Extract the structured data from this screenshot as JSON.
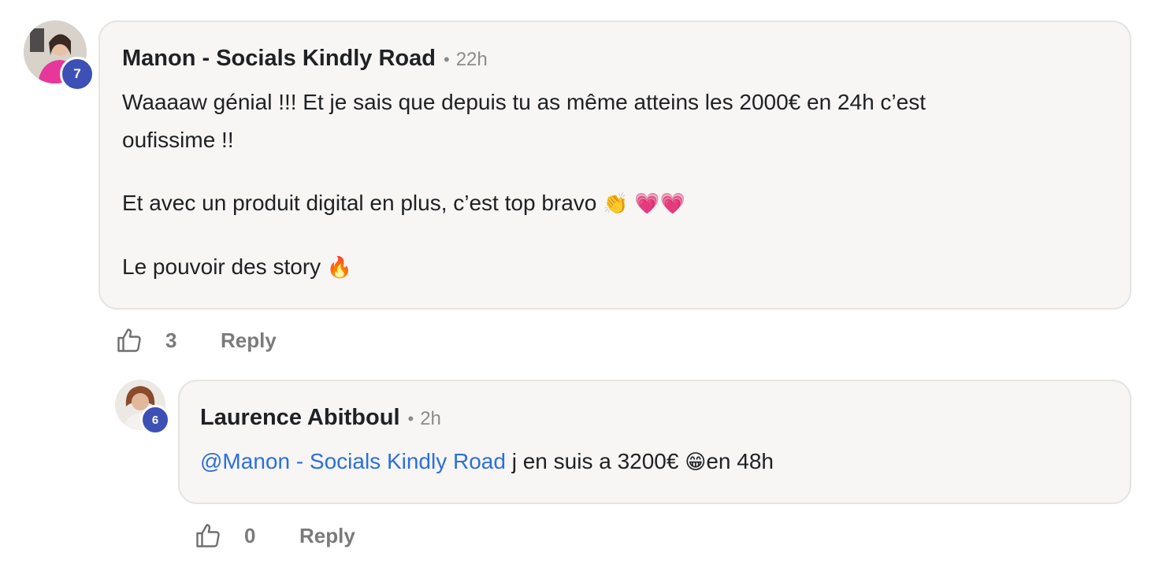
{
  "comments": [
    {
      "author": "Manon - Socials Kindly Road",
      "separator": "•",
      "time": "22h",
      "level": "7",
      "paragraphs": [
        "Waaaaw génial !!! Et je sais que depuis tu as même atteins les 2000€ en 24h c’est",
        "oufissime !!",
        "Et avec un produit digital en plus, c’est top bravo",
        "Le pouvoir des story"
      ],
      "emojis": {
        "clap": "👏",
        "hearts": "💗💗",
        "fire": "🔥"
      },
      "likes": "3",
      "reply_label": "Reply",
      "icons": {
        "like": "thumbs-up-icon"
      }
    },
    {
      "author": "Laurence Abitboul",
      "separator": "•",
      "time": "2h",
      "level": "6",
      "mention": "@Manon - Socials Kindly Road",
      "text": " j en suis a 3200€ ",
      "emoji": "😁",
      "text_after": "en 48h",
      "likes": "0",
      "reply_label": "Reply",
      "icons": {
        "like": "thumbs-up-icon"
      }
    }
  ],
  "colors": {
    "mention": "#2c6fdc",
    "badge": "#3d50b5",
    "bubble_bg": "#f7f6f5",
    "muted_text": "#7b7b7b"
  }
}
